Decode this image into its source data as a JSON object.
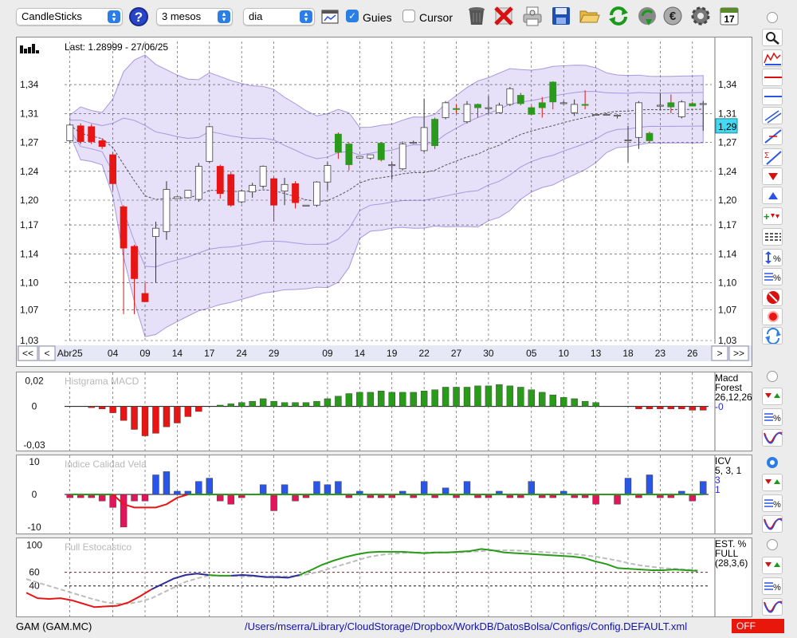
{
  "toolbar": {
    "chart_type": "CandleSticks",
    "period": "3 mesos",
    "interval": "dia",
    "guides_label": "Guies",
    "guides_checked": true,
    "cursor_label": "Cursor",
    "cursor_checked": false,
    "icons": [
      "help-icon",
      "window-icon",
      "trash-icon",
      "delete-icon",
      "print-icon",
      "save-icon",
      "open-folder-icon",
      "refresh-icon",
      "download-icon",
      "currency-icon",
      "gear-icon",
      "calendar-icon"
    ],
    "calendar_day": "17"
  },
  "colors": {
    "up": "#2a9a1a",
    "down": "#e81515",
    "band_fill": "#d6ccf4",
    "band_stroke": "#a898e0",
    "macd_up": "#2a9a1a",
    "macd_down": "#e81515",
    "icv_up": "#2a55e6",
    "icv_down": "#e0155a",
    "stoch_green": "#2a9a1a",
    "stoch_red": "#e81515",
    "stoch_blue": "#2a2a9a",
    "stoch_signal": "#bdbdbd"
  },
  "main_chart": {
    "last_label": "Last: 1.28999 - 27/06/25",
    "last_value_label": "1,29",
    "last_value": 1.29,
    "ymin": 1.03,
    "ymax": 1.37,
    "y_ticks": [
      "1,34",
      "1,31",
      "1,27",
      "1,24",
      "1,20",
      "1,17",
      "1,14",
      "1,10",
      "1,07",
      "1,03"
    ],
    "y_tick_values": [
      1.34,
      1.305,
      1.27,
      1.235,
      1.2,
      1.17,
      1.135,
      1.1,
      1.067,
      1.03
    ],
    "x_labels": [
      "Abr25",
      "04",
      "09",
      "14",
      "17",
      "24",
      "29",
      "09",
      "14",
      "19",
      "22",
      "27",
      "30",
      "05",
      "10",
      "13",
      "18",
      "23",
      "26"
    ],
    "x_label_index": [
      0,
      4,
      7,
      10,
      13,
      16,
      19,
      24,
      27,
      30,
      33,
      36,
      39,
      43,
      46,
      49,
      52,
      55,
      58
    ],
    "candles": [
      [
        1.272,
        1.291,
        1.27,
        1.292
      ],
      [
        1.29,
        1.271,
        1.268,
        1.293
      ],
      [
        1.289,
        1.271,
        1.268,
        1.292
      ],
      [
        1.272,
        1.265,
        1.262,
        1.275
      ],
      [
        1.255,
        1.22,
        1.212,
        1.258
      ],
      [
        1.192,
        1.142,
        1.062,
        1.194
      ],
      [
        1.144,
        1.105,
        1.062,
        1.146
      ],
      [
        1.087,
        1.077,
        1.077,
        1.1
      ],
      [
        1.156,
        1.166,
        1.1,
        1.174
      ],
      [
        1.162,
        1.213,
        1.152,
        1.223
      ],
      [
        1.202,
        1.204,
        1.202,
        1.204
      ],
      [
        1.203,
        1.212,
        1.202,
        1.212
      ],
      [
        1.201,
        1.241,
        1.198,
        1.245
      ],
      [
        1.247,
        1.289,
        1.245,
        1.29
      ],
      [
        1.241,
        1.208,
        1.202,
        1.243
      ],
      [
        1.231,
        1.194,
        1.192,
        1.235
      ],
      [
        1.198,
        1.211,
        1.196,
        1.213
      ],
      [
        1.21,
        1.218,
        1.203,
        1.221
      ],
      [
        1.217,
        1.241,
        1.214,
        1.242
      ],
      [
        1.226,
        1.194,
        1.174,
        1.228
      ],
      [
        1.211,
        1.219,
        1.194,
        1.227
      ],
      [
        1.22,
        1.197,
        1.19,
        1.223
      ],
      [
        1.194,
        1.194,
        1.194,
        1.194
      ],
      [
        1.194,
        1.222,
        1.192,
        1.223
      ],
      [
        1.222,
        1.242,
        1.212,
        1.246
      ],
      [
        1.28,
        1.258,
        1.25,
        1.282
      ],
      [
        1.268,
        1.243,
        1.236,
        1.27
      ],
      [
        1.251,
        1.253,
        1.25,
        1.253
      ],
      [
        1.251,
        1.255,
        1.249,
        1.254
      ],
      [
        1.269,
        1.249,
        1.247,
        1.27
      ],
      [
        1.242,
        1.243,
        1.225,
        1.246
      ],
      [
        1.238,
        1.268,
        1.236,
        1.271
      ],
      [
        1.269,
        1.27,
        1.268,
        1.272
      ],
      [
        1.26,
        1.288,
        1.258,
        1.323
      ],
      [
        1.298,
        1.266,
        1.262,
        1.3
      ],
      [
        1.3,
        1.318,
        1.298,
        1.32
      ],
      [
        1.311,
        1.31,
        1.305,
        1.316
      ],
      [
        1.295,
        1.316,
        1.293,
        1.32
      ],
      [
        1.316,
        1.312,
        1.3,
        1.317
      ],
      [
        1.312,
        1.312,
        1.304,
        1.326
      ],
      [
        1.306,
        1.315,
        1.305,
        1.318
      ],
      [
        1.316,
        1.335,
        1.314,
        1.337
      ],
      [
        1.327,
        1.317,
        1.315,
        1.33
      ],
      [
        1.312,
        1.304,
        1.303,
        1.314
      ],
      [
        1.318,
        1.312,
        1.3,
        1.325
      ],
      [
        1.343,
        1.319,
        1.31,
        1.344
      ],
      [
        1.318,
        1.318,
        1.316,
        1.32
      ],
      [
        1.306,
        1.316,
        1.302,
        1.322
      ],
      [
        1.316,
        1.315,
        1.31,
        1.333
      ],
      [
        1.304,
        1.304,
        1.303,
        1.305
      ],
      [
        1.304,
        1.304,
        1.303,
        1.305
      ],
      [
        1.302,
        1.303,
        1.299,
        1.304
      ],
      [
        1.273,
        1.273,
        1.246,
        1.29
      ],
      [
        1.276,
        1.318,
        1.262,
        1.32
      ],
      [
        1.281,
        1.272,
        1.27,
        1.283
      ],
      [
        1.315,
        1.315,
        1.31,
        1.33
      ],
      [
        1.318,
        1.313,
        1.305,
        1.328
      ],
      [
        1.301,
        1.319,
        1.299,
        1.321
      ],
      [
        1.317,
        1.314,
        1.314,
        1.319
      ],
      [
        1.317,
        1.317,
        1.284,
        1.32
      ]
    ]
  },
  "macd": {
    "title": "Histgrama MACD",
    "legend_line1": "Macd",
    "legend_line2": "Forest",
    "legend_params": "26,12,26",
    "legend_value": "-0",
    "y_ticks": [
      "0,02",
      "0",
      "-0,03"
    ],
    "ymin": -0.032,
    "ymax": 0.024,
    "y_tick_values": [
      0.02,
      0,
      -0.03
    ]
  },
  "icv": {
    "title": "Indice Calidad Vela",
    "legend_line1": "ICV",
    "legend_params": "5, 3, 1",
    "legend_value1": "3",
    "legend_value2": "1",
    "y_ticks": [
      "10",
      "0",
      "-10"
    ],
    "ymin": -11,
    "ymax": 11,
    "y_tick_values": [
      10,
      0,
      -10
    ]
  },
  "stoch": {
    "title": "Full Estocastico",
    "legend_line1": "EST. %",
    "legend_line2": "FULL",
    "legend_params": "(28,3,6)",
    "y_ticks": [
      "100",
      "60",
      "40"
    ],
    "ymin": 0,
    "ymax": 105,
    "y_tick_values": [
      100,
      60,
      40
    ]
  },
  "status": {
    "symbol": "GAM (GAM.MC)",
    "path": "/Users/mserra/Library/CloudStorage/Dropbox/WorkDB/DatosBolsa/Configs/Config.DEFAULT.xml",
    "off_label": "OFF"
  },
  "nav": {
    "first": "<<",
    "prev": "<",
    "next": ">",
    "last": ">>"
  },
  "sidebar": {
    "buttons": [
      "zoom-icon",
      "bar-chart-icon",
      "horizontal-line-icon",
      "horizontal-line-blue-icon",
      "channel-icon",
      "trend-line-icon",
      "sum-trend-icon",
      "arrow-down-icon",
      "arrow-up-icon",
      "add-arrows-icon",
      "list-lines-icon",
      "range-percent-icon",
      "lines-percent-icon",
      "stop-icon",
      "record-icon",
      "swap-icon"
    ]
  }
}
